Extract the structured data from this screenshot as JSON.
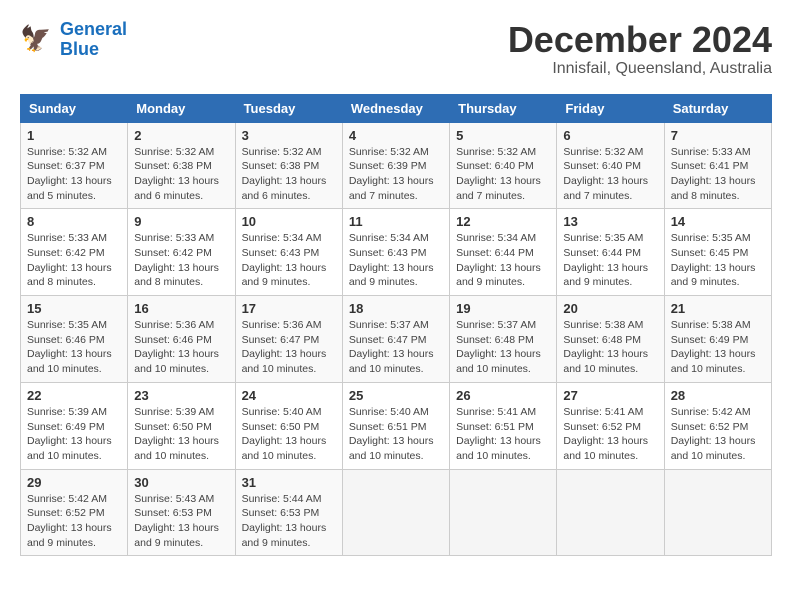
{
  "logo": {
    "line1": "General",
    "line2": "Blue"
  },
  "title": "December 2024",
  "location": "Innisfail, Queensland, Australia",
  "headers": [
    "Sunday",
    "Monday",
    "Tuesday",
    "Wednesday",
    "Thursday",
    "Friday",
    "Saturday"
  ],
  "weeks": [
    [
      {
        "day": "1",
        "info": "Sunrise: 5:32 AM\nSunset: 6:37 PM\nDaylight: 13 hours\nand 5 minutes."
      },
      {
        "day": "2",
        "info": "Sunrise: 5:32 AM\nSunset: 6:38 PM\nDaylight: 13 hours\nand 6 minutes."
      },
      {
        "day": "3",
        "info": "Sunrise: 5:32 AM\nSunset: 6:38 PM\nDaylight: 13 hours\nand 6 minutes."
      },
      {
        "day": "4",
        "info": "Sunrise: 5:32 AM\nSunset: 6:39 PM\nDaylight: 13 hours\nand 7 minutes."
      },
      {
        "day": "5",
        "info": "Sunrise: 5:32 AM\nSunset: 6:40 PM\nDaylight: 13 hours\nand 7 minutes."
      },
      {
        "day": "6",
        "info": "Sunrise: 5:32 AM\nSunset: 6:40 PM\nDaylight: 13 hours\nand 7 minutes."
      },
      {
        "day": "7",
        "info": "Sunrise: 5:33 AM\nSunset: 6:41 PM\nDaylight: 13 hours\nand 8 minutes."
      }
    ],
    [
      {
        "day": "8",
        "info": "Sunrise: 5:33 AM\nSunset: 6:42 PM\nDaylight: 13 hours\nand 8 minutes."
      },
      {
        "day": "9",
        "info": "Sunrise: 5:33 AM\nSunset: 6:42 PM\nDaylight: 13 hours\nand 8 minutes."
      },
      {
        "day": "10",
        "info": "Sunrise: 5:34 AM\nSunset: 6:43 PM\nDaylight: 13 hours\nand 9 minutes."
      },
      {
        "day": "11",
        "info": "Sunrise: 5:34 AM\nSunset: 6:43 PM\nDaylight: 13 hours\nand 9 minutes."
      },
      {
        "day": "12",
        "info": "Sunrise: 5:34 AM\nSunset: 6:44 PM\nDaylight: 13 hours\nand 9 minutes."
      },
      {
        "day": "13",
        "info": "Sunrise: 5:35 AM\nSunset: 6:44 PM\nDaylight: 13 hours\nand 9 minutes."
      },
      {
        "day": "14",
        "info": "Sunrise: 5:35 AM\nSunset: 6:45 PM\nDaylight: 13 hours\nand 9 minutes."
      }
    ],
    [
      {
        "day": "15",
        "info": "Sunrise: 5:35 AM\nSunset: 6:46 PM\nDaylight: 13 hours\nand 10 minutes."
      },
      {
        "day": "16",
        "info": "Sunrise: 5:36 AM\nSunset: 6:46 PM\nDaylight: 13 hours\nand 10 minutes."
      },
      {
        "day": "17",
        "info": "Sunrise: 5:36 AM\nSunset: 6:47 PM\nDaylight: 13 hours\nand 10 minutes."
      },
      {
        "day": "18",
        "info": "Sunrise: 5:37 AM\nSunset: 6:47 PM\nDaylight: 13 hours\nand 10 minutes."
      },
      {
        "day": "19",
        "info": "Sunrise: 5:37 AM\nSunset: 6:48 PM\nDaylight: 13 hours\nand 10 minutes."
      },
      {
        "day": "20",
        "info": "Sunrise: 5:38 AM\nSunset: 6:48 PM\nDaylight: 13 hours\nand 10 minutes."
      },
      {
        "day": "21",
        "info": "Sunrise: 5:38 AM\nSunset: 6:49 PM\nDaylight: 13 hours\nand 10 minutes."
      }
    ],
    [
      {
        "day": "22",
        "info": "Sunrise: 5:39 AM\nSunset: 6:49 PM\nDaylight: 13 hours\nand 10 minutes."
      },
      {
        "day": "23",
        "info": "Sunrise: 5:39 AM\nSunset: 6:50 PM\nDaylight: 13 hours\nand 10 minutes."
      },
      {
        "day": "24",
        "info": "Sunrise: 5:40 AM\nSunset: 6:50 PM\nDaylight: 13 hours\nand 10 minutes."
      },
      {
        "day": "25",
        "info": "Sunrise: 5:40 AM\nSunset: 6:51 PM\nDaylight: 13 hours\nand 10 minutes."
      },
      {
        "day": "26",
        "info": "Sunrise: 5:41 AM\nSunset: 6:51 PM\nDaylight: 13 hours\nand 10 minutes."
      },
      {
        "day": "27",
        "info": "Sunrise: 5:41 AM\nSunset: 6:52 PM\nDaylight: 13 hours\nand 10 minutes."
      },
      {
        "day": "28",
        "info": "Sunrise: 5:42 AM\nSunset: 6:52 PM\nDaylight: 13 hours\nand 10 minutes."
      }
    ],
    [
      {
        "day": "29",
        "info": "Sunrise: 5:42 AM\nSunset: 6:52 PM\nDaylight: 13 hours\nand 9 minutes."
      },
      {
        "day": "30",
        "info": "Sunrise: 5:43 AM\nSunset: 6:53 PM\nDaylight: 13 hours\nand 9 minutes."
      },
      {
        "day": "31",
        "info": "Sunrise: 5:44 AM\nSunset: 6:53 PM\nDaylight: 13 hours\nand 9 minutes."
      },
      {
        "day": "",
        "info": ""
      },
      {
        "day": "",
        "info": ""
      },
      {
        "day": "",
        "info": ""
      },
      {
        "day": "",
        "info": ""
      }
    ]
  ]
}
